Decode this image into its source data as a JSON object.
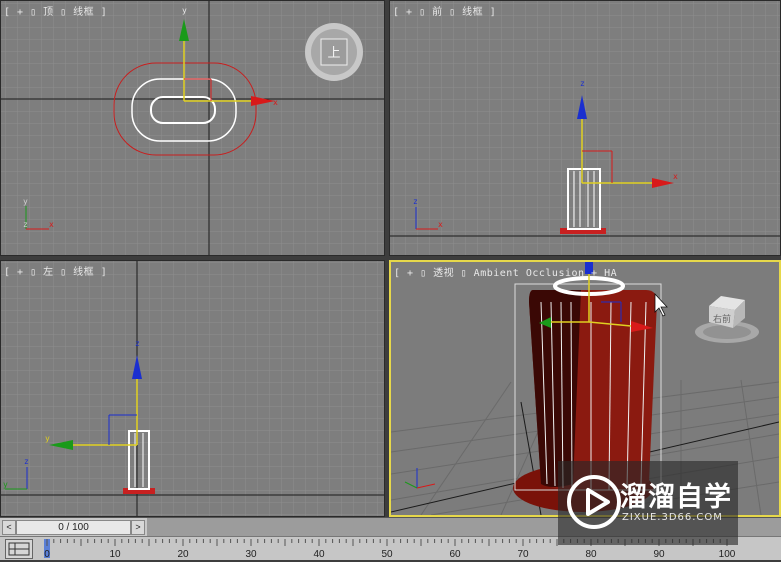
{
  "viewports": {
    "top": {
      "label": "[ + ▯ 顶 ▯ 线框 ]",
      "axis_x": "x",
      "axis_y": "y",
      "axis_z": "z"
    },
    "front": {
      "label": "[ + ▯ 前 ▯ 线框 ]",
      "axis_x": "x",
      "axis_z": "z"
    },
    "left": {
      "label": "[ + ▯ 左 ▯ 线框 ]",
      "axis_y": "y",
      "axis_z": "z"
    },
    "perspective": {
      "label": "[ + ▯ 透视 ▯ Ambient Occlusion + HA",
      "viewcube_face": "右前"
    }
  },
  "viewcube_top_label": "上",
  "timeslider": {
    "prev": "<",
    "position": "0 / 100",
    "next": ">"
  },
  "ruler": {
    "ticks": [
      "0",
      "10",
      "20",
      "30",
      "40",
      "50",
      "60",
      "70",
      "80",
      "90",
      "100"
    ]
  },
  "watermark": {
    "title": "溜溜自学",
    "url": "ZIXUE.3D66.COM"
  },
  "colors": {
    "active_border": "#e6d84a",
    "object_red": "#8b1a10",
    "x_axis": "#e02020",
    "y_axis": "#20b020",
    "z_axis": "#1a2fd0"
  }
}
